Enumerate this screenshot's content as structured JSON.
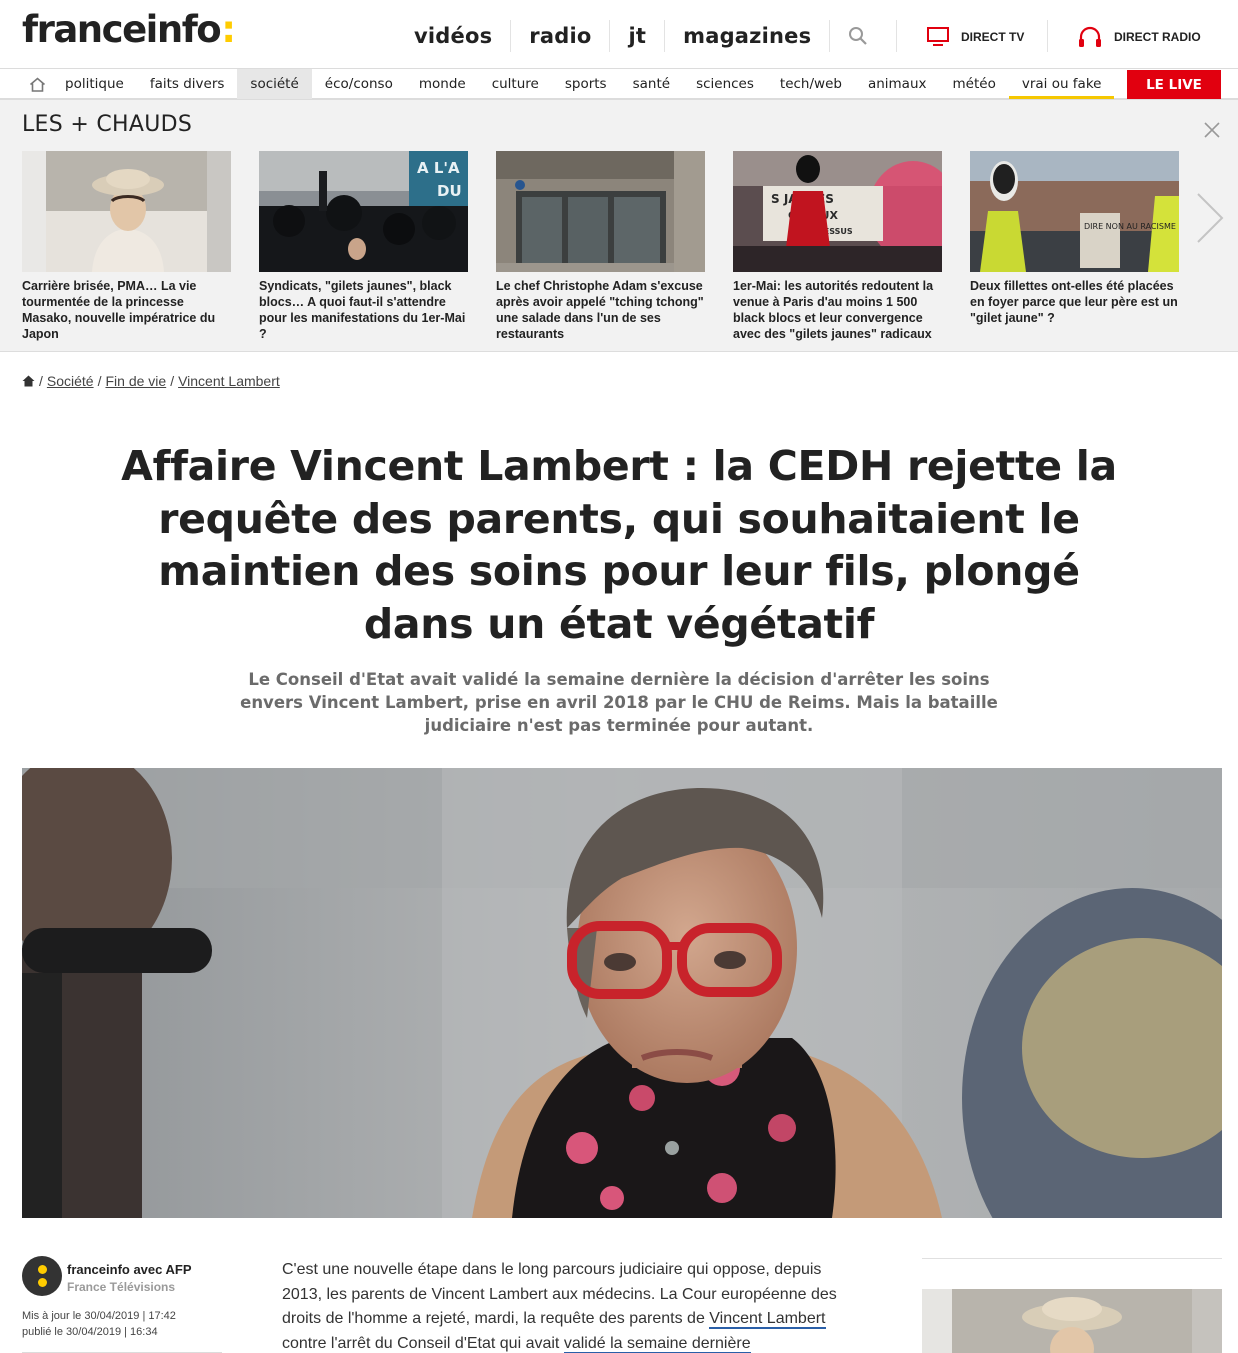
{
  "header": {
    "logo": "franceinfo",
    "logo_colon": ":",
    "nav": [
      "vidéos",
      "radio",
      "jt",
      "magazines"
    ],
    "direct_tv": "DIRECT TV",
    "direct_radio": "DIRECT RADIO"
  },
  "subnav": {
    "items": [
      "politique",
      "faits divers",
      "société",
      "éco/conso",
      "monde",
      "culture",
      "sports",
      "santé",
      "sciences",
      "tech/web",
      "animaux",
      "météo",
      "vrai ou fake"
    ],
    "active": "société",
    "live": "LE LIVE"
  },
  "hot": {
    "title": "LES + CHAUDS",
    "cards": [
      {
        "caption": "Carrière brisée, PMA… La vie tourmentée de la princesse Masako, nouvelle impératrice du Japon"
      },
      {
        "caption": "Syndicats, \"gilets jaunes\", black blocs… A quoi faut-il s'attendre pour les manifestations du 1er-Mai ?",
        "sign_top": "A L'A",
        "sign_bot": "DU"
      },
      {
        "caption": "Le chef Christophe Adam s'excuse après avoir appelé \"tching tchong\" une salade dans l'un de ses restaurants"
      },
      {
        "caption": "1er-Mai: les autorités redoutent la venue à Paris d'au moins 1 500 black blocs et leur convergence avec des \"gilets jaunes\" radicaux",
        "banner1": "S JAUNES",
        "banner2": "GEREUX",
        "banner3": "HIER DESSUS"
      },
      {
        "caption": "Deux fillettes ont-elles été placées en foyer parce que leur père est un \"gilet jaune\" ?",
        "sign": "DIRE NON AU RACISME"
      }
    ]
  },
  "breadcrumb": [
    "Société",
    "Fin de vie",
    "Vincent Lambert"
  ],
  "article": {
    "title": "Affaire Vincent Lambert : la CEDH rejette la requête des parents, qui souhaitaient le maintien des soins pour leur fils, plongé dans un état végétatif",
    "chapo": "Le Conseil d'Etat avait validé la semaine dernière la décision d'arrêter les soins envers Vincent Lambert, prise en avril 2018 par le CHU de Reims. Mais la bataille judiciaire n'est pas terminée pour autant.",
    "author": "franceinfo avec AFP",
    "org": "France Télévisions",
    "updated": "Mis à jour le 30/04/2019 | 17:42",
    "published": "publié le 30/04/2019 | 16:34",
    "body_1": "C'est une nouvelle étape dans le long parcours judiciaire qui oppose, depuis 2013, les parents de Vincent Lambert aux médecins. La Cour européenne des droits de l'homme a rejeté, mardi, la requête des parents de ",
    "body_link_1": "Vincent Lambert",
    "body_2": " contre l'arrêt du Conseil d'Etat qui avait ",
    "body_link_2": "validé la semaine dernière"
  },
  "colors": {
    "accent_yellow": "#ffcc00",
    "live_red": "#e1000f",
    "link_blue": "#2a5fa8"
  },
  "icons": [
    "home-icon",
    "search-icon",
    "tv-icon",
    "headphones-icon",
    "close-icon",
    "chevron-right-icon"
  ]
}
